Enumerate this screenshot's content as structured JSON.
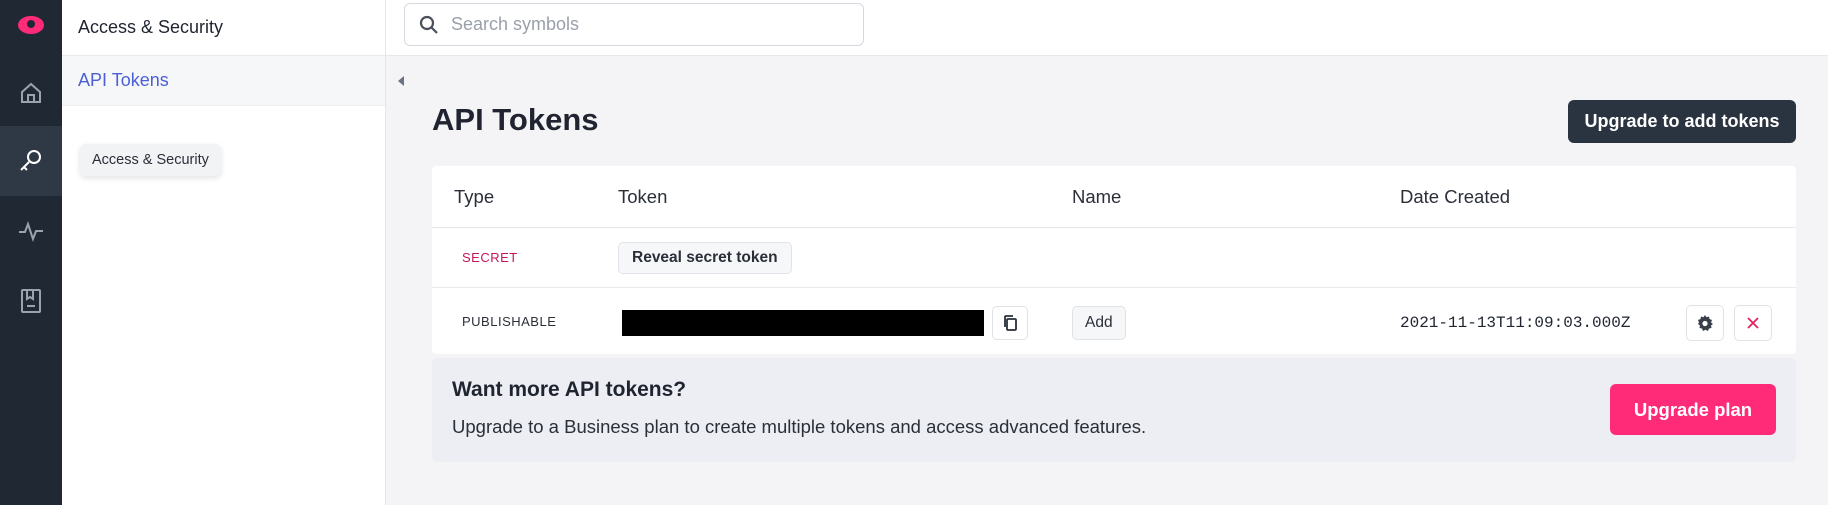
{
  "rail": {
    "items": [
      {
        "name": "logo",
        "icon": "cloud-logo-icon"
      },
      {
        "name": "home",
        "icon": "home-icon"
      },
      {
        "name": "access-security",
        "icon": "key-icon",
        "active": true
      },
      {
        "name": "activity",
        "icon": "activity-icon"
      },
      {
        "name": "docs",
        "icon": "book-icon"
      }
    ]
  },
  "sidebar": {
    "title": "Access & Security",
    "items": [
      {
        "label": "API Tokens",
        "active": true
      }
    ]
  },
  "tooltip": {
    "text": "Access & Security"
  },
  "search": {
    "placeholder": "Search symbols"
  },
  "page": {
    "title": "API Tokens",
    "upgrade_button": "Upgrade to add tokens"
  },
  "table": {
    "columns": [
      "Type",
      "Token",
      "Name",
      "Date Created"
    ],
    "rows": [
      {
        "type": "SECRET",
        "token_action": "Reveal secret token",
        "name": "",
        "date": ""
      },
      {
        "type": "PUBLISHABLE",
        "token": "[redacted]",
        "name_action": "Add",
        "date": "2021-11-13T11:09:03.000Z"
      }
    ]
  },
  "promo": {
    "title": "Want more API tokens?",
    "description": "Upgrade to a Business plan to create multiple tokens and access advanced features.",
    "button": "Upgrade plan"
  },
  "colors": {
    "accent": "#ff2b78",
    "dark_button": "#2a3340",
    "rail_bg": "#1f2833",
    "link": "#4b5fd6",
    "secret_badge": "#c2185b"
  }
}
